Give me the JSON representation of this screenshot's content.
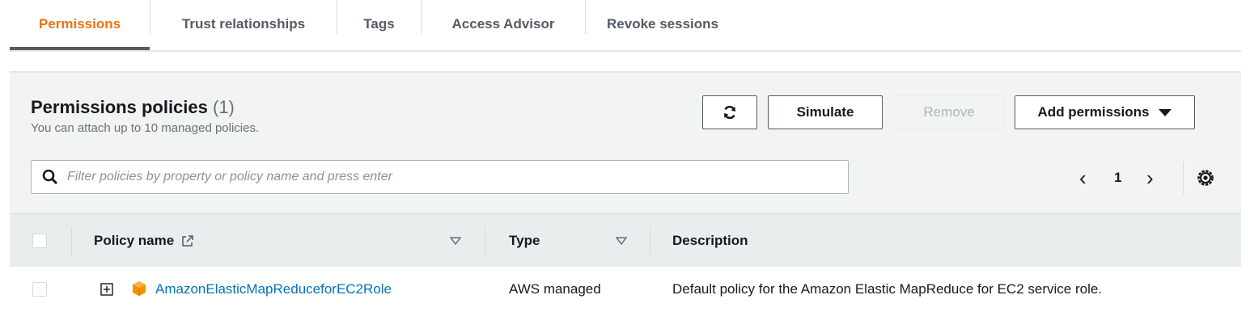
{
  "tabs": [
    {
      "label": "Permissions",
      "active": true
    },
    {
      "label": "Trust relationships",
      "active": false
    },
    {
      "label": "Tags",
      "active": false
    },
    {
      "label": "Access Advisor",
      "active": false
    },
    {
      "label": "Revoke sessions",
      "active": false
    }
  ],
  "panel": {
    "title": "Permissions policies",
    "count": "(1)",
    "subtitle": "You can attach up to 10 managed policies."
  },
  "buttons": {
    "refresh_icon": "refresh-icon",
    "simulate": "Simulate",
    "remove": "Remove",
    "add_permissions": "Add permissions"
  },
  "search": {
    "placeholder": "Filter policies by property or policy name and press enter",
    "value": ""
  },
  "pagination": {
    "current_page": "1",
    "prev": "‹",
    "next": "›"
  },
  "table": {
    "columns": [
      "Policy name",
      "Type",
      "Description"
    ],
    "rows": [
      {
        "policy_name": "AmazonElasticMapReduceforEC2Role",
        "type": "AWS managed",
        "description": "Default policy for the Amazon Elastic MapReduce for EC2 service role."
      }
    ]
  },
  "colors": {
    "active_tab": "#ec7211",
    "link": "#0073bb",
    "policy_icon": "#f29100"
  }
}
